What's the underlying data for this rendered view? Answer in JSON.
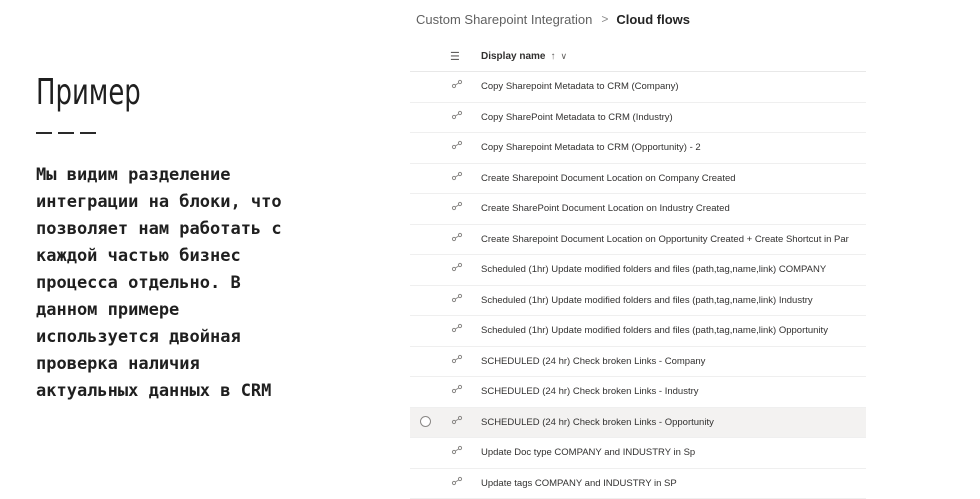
{
  "slide": {
    "title": "Пример",
    "body": "Мы видим разделение\nинтеграции на блоки, что\nпозволяет нам работать с\nкаждой частью бизнес\nпроцесса отдельно. В\nданном примере\nиспользуется двойная\nпроверка наличия\nактуальных данных в CRM"
  },
  "breadcrumb": {
    "parent": "Custom Sharepoint Integration",
    "separator": ">",
    "current": "Cloud flows"
  },
  "table": {
    "header": {
      "column_label": "Display name",
      "sort_glyph": "↑",
      "menu_glyph": "∨",
      "list_icon": "list-icon"
    },
    "rows": [
      {
        "name": "Copy Sharepoint Metadata to CRM (Company)",
        "selected": false
      },
      {
        "name": "Copy SharePoint Metadata to CRM (Industry)",
        "selected": false
      },
      {
        "name": "Copy Sharepoint Metadata to CRM (Opportunity) - 2",
        "selected": false
      },
      {
        "name": "Create Sharepoint Document Location on Company Created",
        "selected": false
      },
      {
        "name": "Create SharePoint Document Location on Industry Created",
        "selected": false
      },
      {
        "name": "Create Sharepoint Document Location on Opportunity Created + Create Shortcut in Par",
        "selected": false
      },
      {
        "name": "Scheduled (1hr) Update modified folders and files (path,tag,name,link) COMPANY",
        "selected": false
      },
      {
        "name": "Scheduled (1hr) Update modified folders and files (path,tag,name,link) Industry",
        "selected": false
      },
      {
        "name": "Scheduled (1hr) Update modified folders and files (path,tag,name,link) Opportunity",
        "selected": false
      },
      {
        "name": "SCHEDULED (24 hr) Check broken Links - Company",
        "selected": false
      },
      {
        "name": "SCHEDULED (24 hr) Check broken Links - Industry",
        "selected": false
      },
      {
        "name": "SCHEDULED (24 hr) Check broken Links - Opportunity",
        "selected": true
      },
      {
        "name": "Update Doc type COMPANY and INDUSTRY in Sp",
        "selected": false
      },
      {
        "name": "Update tags COMPANY and INDUSTRY in SP",
        "selected": false
      }
    ],
    "row_icon": "flow-icon"
  },
  "colors": {
    "text": "#323130",
    "selected_row": "#f3f2f1",
    "divider": "#2a2a2a"
  }
}
